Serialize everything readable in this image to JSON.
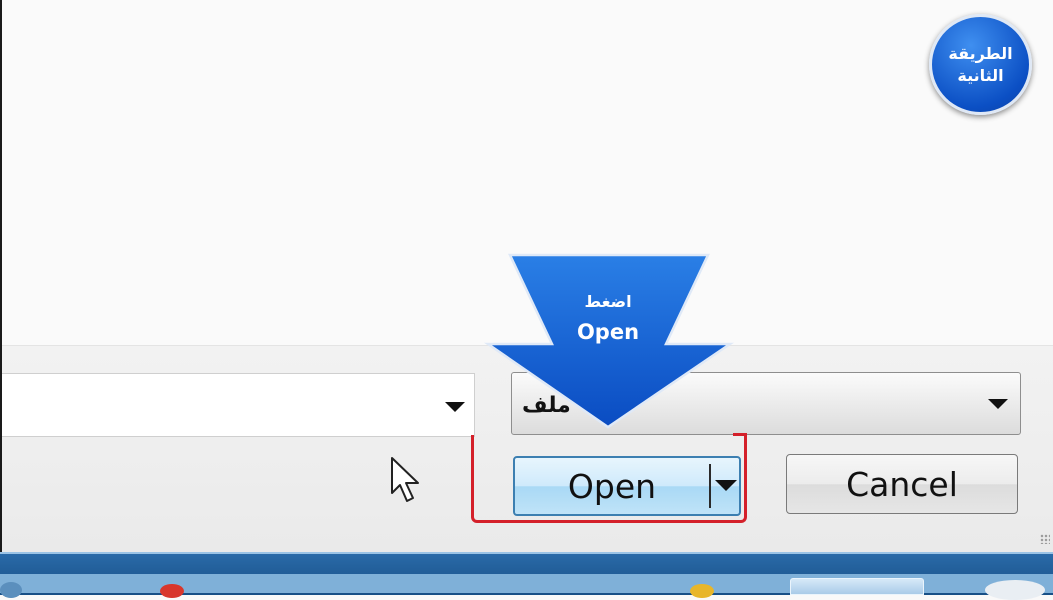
{
  "badge": {
    "text": "الطريقة الثانية"
  },
  "callout": {
    "line1": "اضغط",
    "line2": "Open"
  },
  "dialog": {
    "file_name_value": "",
    "file_type_value": "ملف",
    "open_label": "Open",
    "cancel_label": "Cancel"
  },
  "icons": [
    "chevron-down-icon",
    "mouse-pointer-icon",
    "down-arrow-callout-icon"
  ],
  "colors": {
    "highlight": "#d4202a",
    "accent_blue": "#0b4fc4",
    "open_button_border": "#3c7fb1",
    "taskbar": "#1f5f9a"
  }
}
